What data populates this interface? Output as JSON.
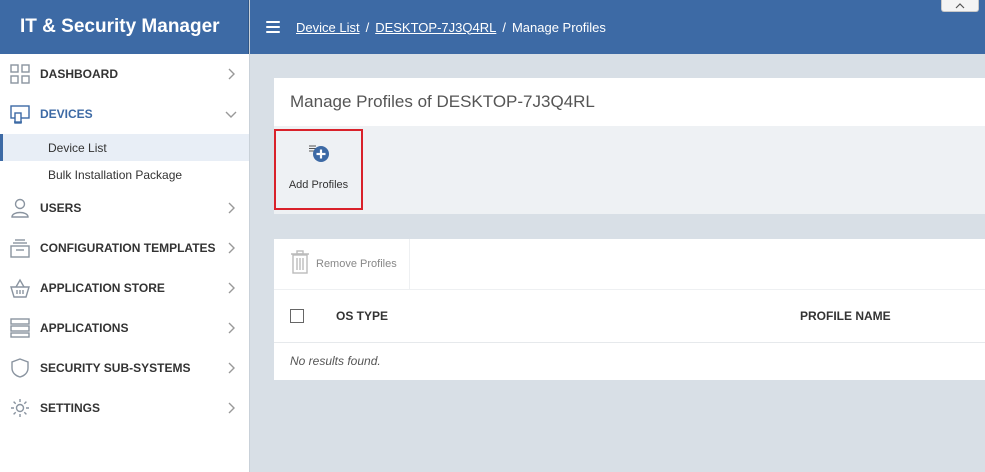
{
  "app": {
    "title": "IT & Security Manager"
  },
  "sidebar": {
    "items": [
      {
        "label": "DASHBOARD",
        "icon": "dashboard-icon"
      },
      {
        "label": "DEVICES",
        "icon": "devices-icon"
      },
      {
        "label": "USERS",
        "icon": "user-icon"
      },
      {
        "label": "CONFIGURATION TEMPLATES",
        "icon": "templates-icon"
      },
      {
        "label": "APPLICATION STORE",
        "icon": "basket-icon"
      },
      {
        "label": "APPLICATIONS",
        "icon": "applications-icon"
      },
      {
        "label": "SECURITY SUB-SYSTEMS",
        "icon": "shield-icon"
      },
      {
        "label": "SETTINGS",
        "icon": "gear-icon"
      }
    ],
    "devices_sub": [
      {
        "label": "Device List"
      },
      {
        "label": "Bulk Installation Package"
      }
    ]
  },
  "breadcrumb": {
    "items": [
      "Device List",
      "DESKTOP-7J3Q4RL",
      "Manage Profiles"
    ],
    "separator": "/"
  },
  "page": {
    "title": "Manage Profiles of DESKTOP-7J3Q4RL"
  },
  "toolbar": {
    "add_label": "Add Profiles",
    "remove_label": "Remove Profiles"
  },
  "table": {
    "columns": [
      "OS TYPE",
      "PROFILE NAME"
    ],
    "empty_text": "No results found."
  },
  "colors": {
    "brand": "#3d6aa5",
    "highlight": "#d9212a",
    "background": "#d8dfe6"
  }
}
